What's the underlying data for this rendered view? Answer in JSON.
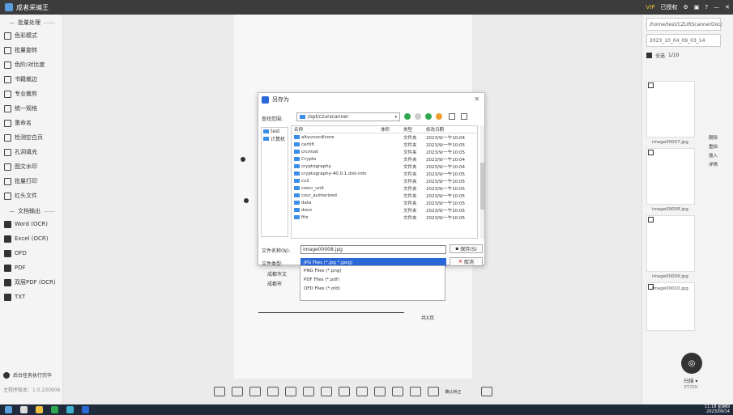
{
  "app": {
    "title": "成者采编王",
    "vip": "VIP",
    "auth": "已授权"
  },
  "sidebar": {
    "section_batch": "批量处理",
    "batch_items": [
      "色彩模式",
      "批量旋转",
      "色阶/对比度",
      "书籍裁边",
      "专业裁剪",
      "统一规格",
      "重命名",
      "检测空白页",
      "孔洞填充",
      "图文水印",
      "批量打印",
      "红头文件"
    ],
    "section_output": "文档输出",
    "output_items": [
      "Word (OCR)",
      "Excel (OCR)",
      "OFD",
      "PDF",
      "双层PDF (OCR)",
      "TXT"
    ],
    "task_label": "后台任务执行完毕",
    "version": "主程序版本：1.0.230906"
  },
  "right": {
    "path": "/home/test/CZURScannerDoc/",
    "folder": "2023_10_04_09_03_14",
    "select_all": "全选",
    "count": "1/10",
    "thumbs": [
      "image00007.jpg",
      "image00008.jpg",
      "image00009.jpg",
      "image00010.jpg"
    ],
    "context_menu": [
      "删除",
      "重拍",
      "插入",
      "详情"
    ],
    "scan_label": "扫描 ▾",
    "device": "ET25N"
  },
  "page": {
    "text1": "共X页",
    "text2": "成都市文",
    "text3": "成都市"
  },
  "toolbar": {
    "ok_label": "确认矫正"
  },
  "dialog": {
    "title": "另存为",
    "look_in_label": "查找范围:",
    "look_in_value": "/opt/czurscanner",
    "places": [
      "test",
      "计算机"
    ],
    "columns": [
      "名称",
      "体积",
      "类型",
      "修改日期"
    ],
    "files": [
      [
        "altyunocdlcore",
        "文件夹",
        "2023/9/一午10:04"
      ],
      [
        "certifi",
        "文件夹",
        "2023/9/一午10:05"
      ],
      [
        "crcmod",
        "文件夹",
        "2023/9/一午10:05"
      ],
      [
        "Crypto",
        "文件夹",
        "2023/9/一午10:04"
      ],
      [
        "cryptography",
        "文件夹",
        "2023/9/一午10:04"
      ],
      [
        "cryptography-40.0.1.dist-info",
        "文件夹",
        "2023/9/一午10:05"
      ],
      [
        "cv2",
        "文件夹",
        "2023/9/一午10:05"
      ],
      [
        "czocr_unit",
        "文件夹",
        "2023/9/一午10:05"
      ],
      [
        "czur_authorized",
        "文件夹",
        "2023/9/一午10:05"
      ],
      [
        "data",
        "文件夹",
        "2023/9/一午10:05"
      ],
      [
        "docx",
        "文件夹",
        "2023/9/一午10:05"
      ],
      [
        "fitz",
        "文件夹",
        "2023/9/一午10:05"
      ]
    ],
    "filename_label": "文件名称(N):",
    "filename_value": "image00008.jpg",
    "filetype_label": "文件类型:",
    "filetype_value": "JPG Files (*.jpg *.jpeg)",
    "save_label": "保存(S)",
    "cancel_label": "取消",
    "type_options": [
      "PNG Files (*.png)",
      "PDF Files (*.pdf)",
      "OFD Files (*.ofd)"
    ]
  },
  "taskbar": {
    "time": "11:18 星期四",
    "date": "2023/09/14"
  }
}
